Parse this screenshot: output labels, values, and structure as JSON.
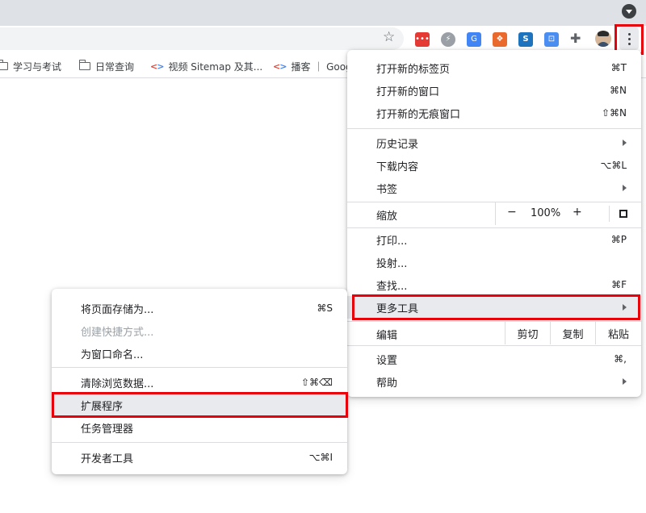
{
  "toolbar": {
    "extensions": [
      {
        "name": "ext-red-dots-icon",
        "glyph": "•••",
        "color": "#e53935"
      },
      {
        "name": "ext-lightning-icon",
        "glyph": "⚡",
        "color": "#9aa0a6"
      },
      {
        "name": "ext-translate-icon",
        "glyph": "G",
        "color": "#4285f4"
      },
      {
        "name": "ext-badge-icon",
        "glyph": "❖",
        "color": "#ea6a2e"
      },
      {
        "name": "ext-s-icon",
        "glyph": "S",
        "color": "#1e73be"
      },
      {
        "name": "ext-card-icon",
        "glyph": "⊡",
        "color": "#4a8ef2"
      }
    ]
  },
  "bookmarks": [
    {
      "label": "学习与考试",
      "icon": "folder"
    },
    {
      "label": "日常查询",
      "icon": "folder"
    },
    {
      "label": "视频 Sitemap 及其...",
      "icon": "code"
    },
    {
      "label": "播客 ｜ Goog",
      "icon": "code"
    }
  ],
  "main_menu": {
    "new_tab": {
      "label": "打开新的标签页",
      "shortcut": "⌘T"
    },
    "new_window": {
      "label": "打开新的窗口",
      "shortcut": "⌘N"
    },
    "incognito": {
      "label": "打开新的无痕窗口",
      "shortcut": "⇧⌘N"
    },
    "history": {
      "label": "历史记录"
    },
    "downloads": {
      "label": "下载内容",
      "shortcut": "⌥⌘L"
    },
    "bookmarks": {
      "label": "书签"
    },
    "zoom": {
      "label": "缩放",
      "minus": "−",
      "value": "100%",
      "plus": "+"
    },
    "print": {
      "label": "打印...",
      "shortcut": "⌘P"
    },
    "cast": {
      "label": "投射..."
    },
    "find": {
      "label": "查找...",
      "shortcut": "⌘F"
    },
    "more_tools": {
      "label": "更多工具"
    },
    "edit": {
      "label": "编辑",
      "cut": "剪切",
      "copy": "复制",
      "paste": "粘贴"
    },
    "settings": {
      "label": "设置",
      "shortcut": "⌘,"
    },
    "help": {
      "label": "帮助"
    }
  },
  "sub_menu": {
    "save_page": {
      "label": "将页面存储为...",
      "shortcut": "⌘S"
    },
    "create_shortcut": {
      "label": "创建快捷方式..."
    },
    "name_window": {
      "label": "为窗口命名..."
    },
    "clear_data": {
      "label": "清除浏览数据...",
      "shortcut": "⇧⌘⌫"
    },
    "extensions": {
      "label": "扩展程序"
    },
    "task_manager": {
      "label": "任务管理器"
    },
    "dev_tools": {
      "label": "开发者工具",
      "shortcut": "⌥⌘I"
    }
  },
  "colors": {
    "highlight_box": "#e8000b",
    "menu_hover": "#e8eaed"
  }
}
